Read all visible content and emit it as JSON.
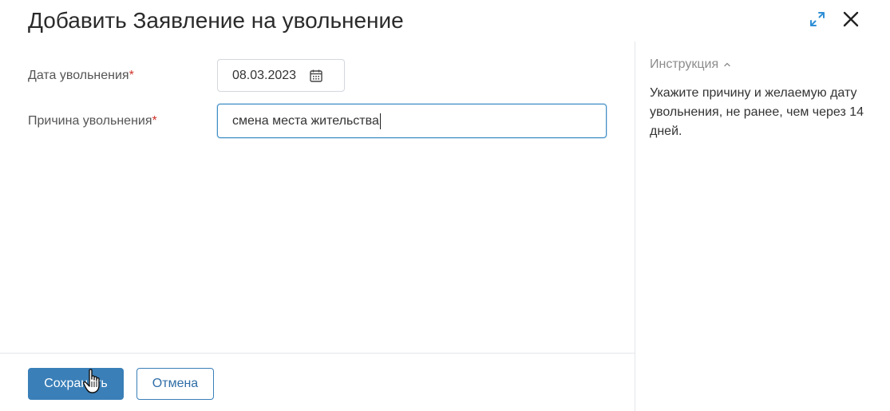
{
  "dialog": {
    "title": "Добавить Заявление на увольнение",
    "icons": {
      "expand": "expand-icon",
      "close": "close-icon"
    }
  },
  "form": {
    "date_label": "Дата увольнения",
    "date_value": "08.03.2023",
    "reason_label": "Причина увольнения",
    "reason_value": "смена места жительства",
    "required_mark": "*"
  },
  "instructions": {
    "header": "Инструкция",
    "text": "Укажите причину и желаемую дату увольнения, не ранее, чем через 14 дней."
  },
  "footer": {
    "save_label": "Сохранить",
    "cancel_label": "Отмена"
  },
  "colors": {
    "primary": "#3a7fb8",
    "required": "#d0342c",
    "focus_border": "#3e8dc5"
  }
}
